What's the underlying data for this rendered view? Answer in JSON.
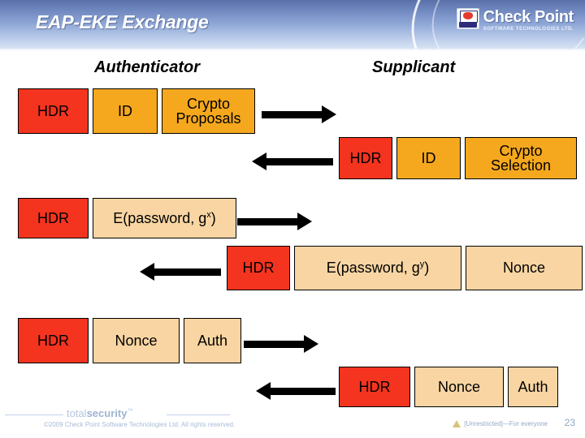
{
  "header": {
    "title": "EAP-EKE Exchange",
    "logo": {
      "wordmark": "Check Point",
      "tagline": "SOFTWARE TECHNOLOGIES LTD."
    }
  },
  "diagram": {
    "parties": {
      "left": "Authenticator",
      "right": "Supplicant"
    },
    "messages": [
      {
        "direction": "right",
        "side": "left",
        "boxes": [
          {
            "label": "HDR",
            "color": "red"
          },
          {
            "label": "ID",
            "color": "orange"
          },
          {
            "label": "Crypto Proposals",
            "color": "orange"
          }
        ]
      },
      {
        "direction": "left",
        "side": "right",
        "boxes": [
          {
            "label": "HDR",
            "color": "red"
          },
          {
            "label": "ID",
            "color": "orange"
          },
          {
            "label": "Crypto Selection",
            "color": "orange"
          }
        ]
      },
      {
        "direction": "right",
        "side": "left",
        "boxes": [
          {
            "label": "HDR",
            "color": "red"
          },
          {
            "label": "E(password, g",
            "sup": "x",
            "suffix": ")",
            "color": "peach"
          }
        ]
      },
      {
        "direction": "left",
        "side": "right",
        "boxes": [
          {
            "label": "HDR",
            "color": "red"
          },
          {
            "label": "E(password, g",
            "sup": "y",
            "suffix": ")",
            "color": "peach"
          },
          {
            "label": "Nonce",
            "color": "peach"
          }
        ]
      },
      {
        "direction": "right",
        "side": "left",
        "boxes": [
          {
            "label": "HDR",
            "color": "red"
          },
          {
            "label": "Nonce",
            "color": "peach"
          },
          {
            "label": "Auth",
            "color": "peach"
          }
        ]
      },
      {
        "direction": "left",
        "side": "right",
        "boxes": [
          {
            "label": "HDR",
            "color": "red"
          },
          {
            "label": "Nonce",
            "color": "peach"
          },
          {
            "label": "Auth",
            "color": "peach"
          }
        ]
      }
    ]
  },
  "footer": {
    "brand_light": "total",
    "brand_bold": "security",
    "brand_tm": "™",
    "copyright": "©2009 Check Point Software Technologies Ltd. All rights reserved.",
    "classification": "[Unrestricted]—For everyone",
    "page_number": "23"
  },
  "colors": {
    "header_top": "#5a6fa8",
    "header_bottom": "#dce7f5",
    "box_red": "#f4341f",
    "box_orange": "#f5a81e",
    "box_peach": "#f8d5a2",
    "arrow": "#000000"
  }
}
